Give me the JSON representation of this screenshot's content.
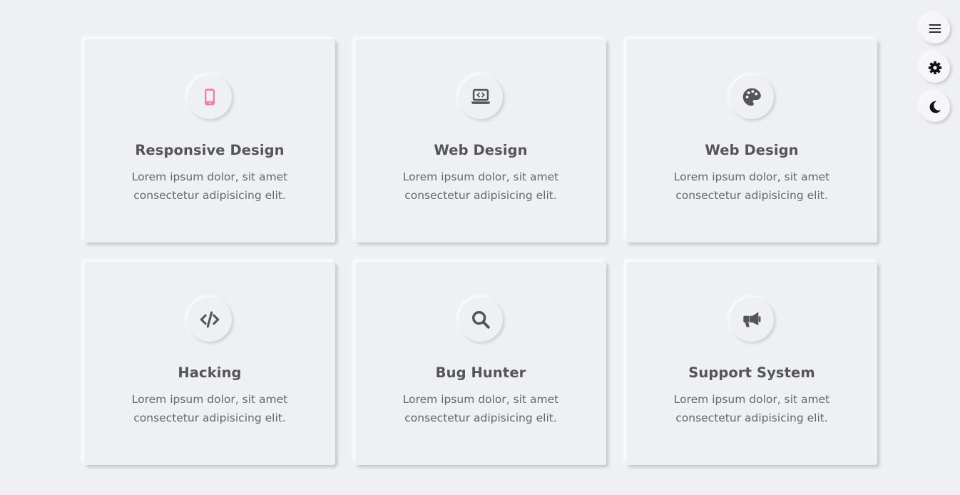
{
  "colors": {
    "background": "#eff0f4",
    "text": "#555555",
    "icon": "#555555",
    "accent_icon": "#f4829b"
  },
  "cards": [
    {
      "icon": "mobile-icon",
      "title": "Responsive Design",
      "description": "Lorem ipsum dolor, sit amet consectetur adipisicing elit."
    },
    {
      "icon": "laptop-code-icon",
      "title": "Web Design",
      "description": "Lorem ipsum dolor, sit amet consectetur adipisicing elit."
    },
    {
      "icon": "palette-icon",
      "title": "Web Design",
      "description": "Lorem ipsum dolor, sit amet consectetur adipisicing elit."
    },
    {
      "icon": "code-icon",
      "title": "Hacking",
      "description": "Lorem ipsum dolor, sit amet consectetur adipisicing elit."
    },
    {
      "icon": "search-icon",
      "title": "Bug Hunter",
      "description": "Lorem ipsum dolor, sit amet consectetur adipisicing elit."
    },
    {
      "icon": "megaphone-icon",
      "title": "Support System",
      "description": "Lorem ipsum dolor, sit amet consectetur adipisicing elit."
    }
  ],
  "side_buttons": [
    {
      "icon": "menu-icon"
    },
    {
      "icon": "gear-icon"
    },
    {
      "icon": "moon-icon"
    }
  ]
}
